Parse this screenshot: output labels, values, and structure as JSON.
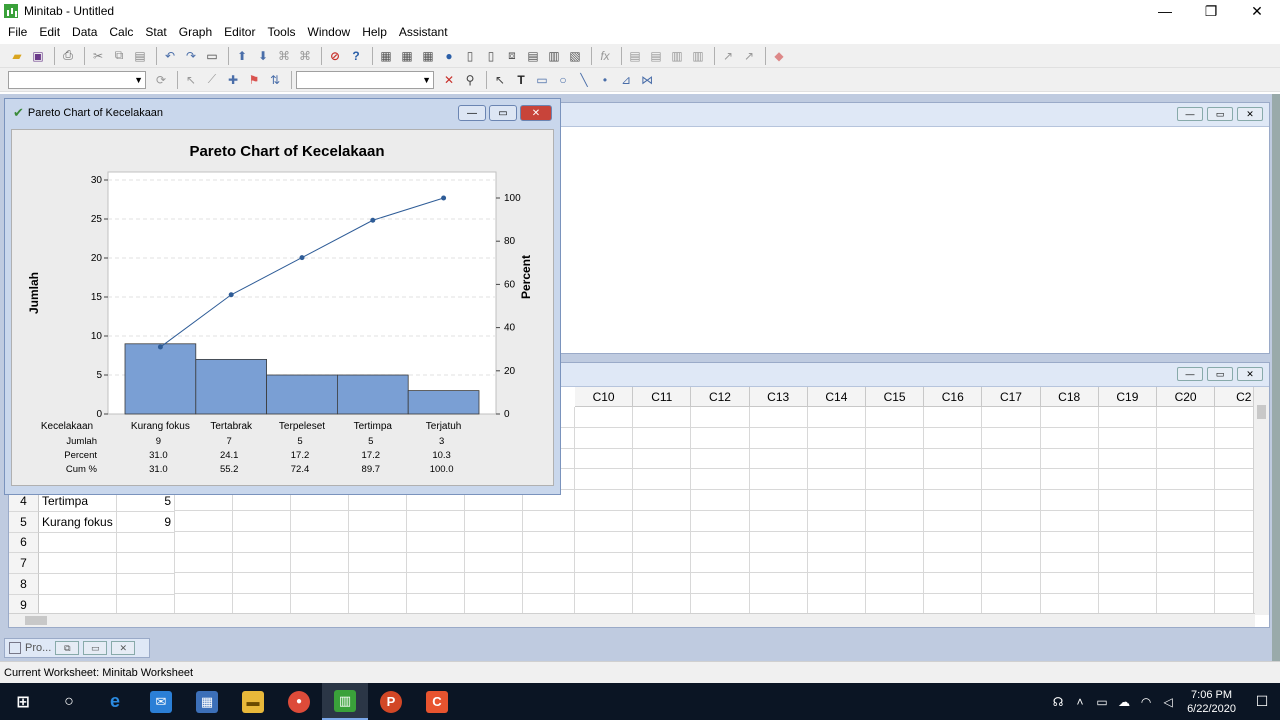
{
  "window": {
    "title": "Minitab - Untitled"
  },
  "window_controls": {
    "minimize": "—",
    "restore": "❐",
    "close": "✕"
  },
  "menu": [
    "File",
    "Edit",
    "Data",
    "Calc",
    "Stat",
    "Graph",
    "Editor",
    "Tools",
    "Window",
    "Help",
    "Assistant"
  ],
  "chart_window": {
    "title": "Pareto Chart of Kecelakaan",
    "controls": {
      "minimize": "—",
      "maximize": "▭",
      "close": "✕"
    }
  },
  "chart_data": {
    "type": "bar",
    "title": "Pareto Chart of Kecelakaan",
    "categories": [
      "Kurang fokus",
      "Tertabrak",
      "Terpeleset",
      "Tertimpa",
      "Terjatuh"
    ],
    "values": [
      9,
      7,
      5,
      5,
      3
    ],
    "cumulative_percent_line": [
      31.0,
      55.2,
      72.4,
      89.7,
      100.0
    ],
    "ylabel": "Jumlah",
    "y2label": "Percent",
    "ylim": [
      0,
      30
    ],
    "y2lim": [
      0,
      100
    ],
    "yticks": [
      0,
      5,
      10,
      15,
      20,
      25,
      30
    ],
    "y2ticks": [
      0,
      20,
      40,
      60,
      80,
      100
    ],
    "bar_color": "#7a9fd4",
    "line_color": "#2e5c97",
    "table": {
      "header": "Kecelakaan",
      "rows": [
        {
          "label": "Jumlah",
          "values": [
            "9",
            "7",
            "5",
            "5",
            "3"
          ]
        },
        {
          "label": "Percent",
          "values": [
            "31.0",
            "24.1",
            "17.2",
            "17.2",
            "10.3"
          ]
        },
        {
          "label": "Cum %",
          "values": [
            "31.0",
            "55.2",
            "72.4",
            "89.7",
            "100.0"
          ]
        }
      ]
    },
    "grid": true
  },
  "worksheet": {
    "column_headers": [
      "C10",
      "C11",
      "C12",
      "C13",
      "C14",
      "C15",
      "C16",
      "C17",
      "C18",
      "C19",
      "C20",
      "C2"
    ],
    "rows": [
      {
        "num": "4",
        "c1": "Tertimpa",
        "c2": "5"
      },
      {
        "num": "5",
        "c1": "Kurang fokus",
        "c2": "9"
      },
      {
        "num": "6",
        "c1": "",
        "c2": ""
      },
      {
        "num": "7",
        "c1": "",
        "c2": ""
      },
      {
        "num": "8",
        "c1": "",
        "c2": ""
      },
      {
        "num": "9",
        "c1": "",
        "c2": ""
      }
    ]
  },
  "project_minimized": {
    "label": "Pro..."
  },
  "status": {
    "text": "Current Worksheet: Minitab Worksheet"
  },
  "taskbar": {
    "clock_time": "7:06 PM",
    "clock_date": "6/22/2020"
  }
}
